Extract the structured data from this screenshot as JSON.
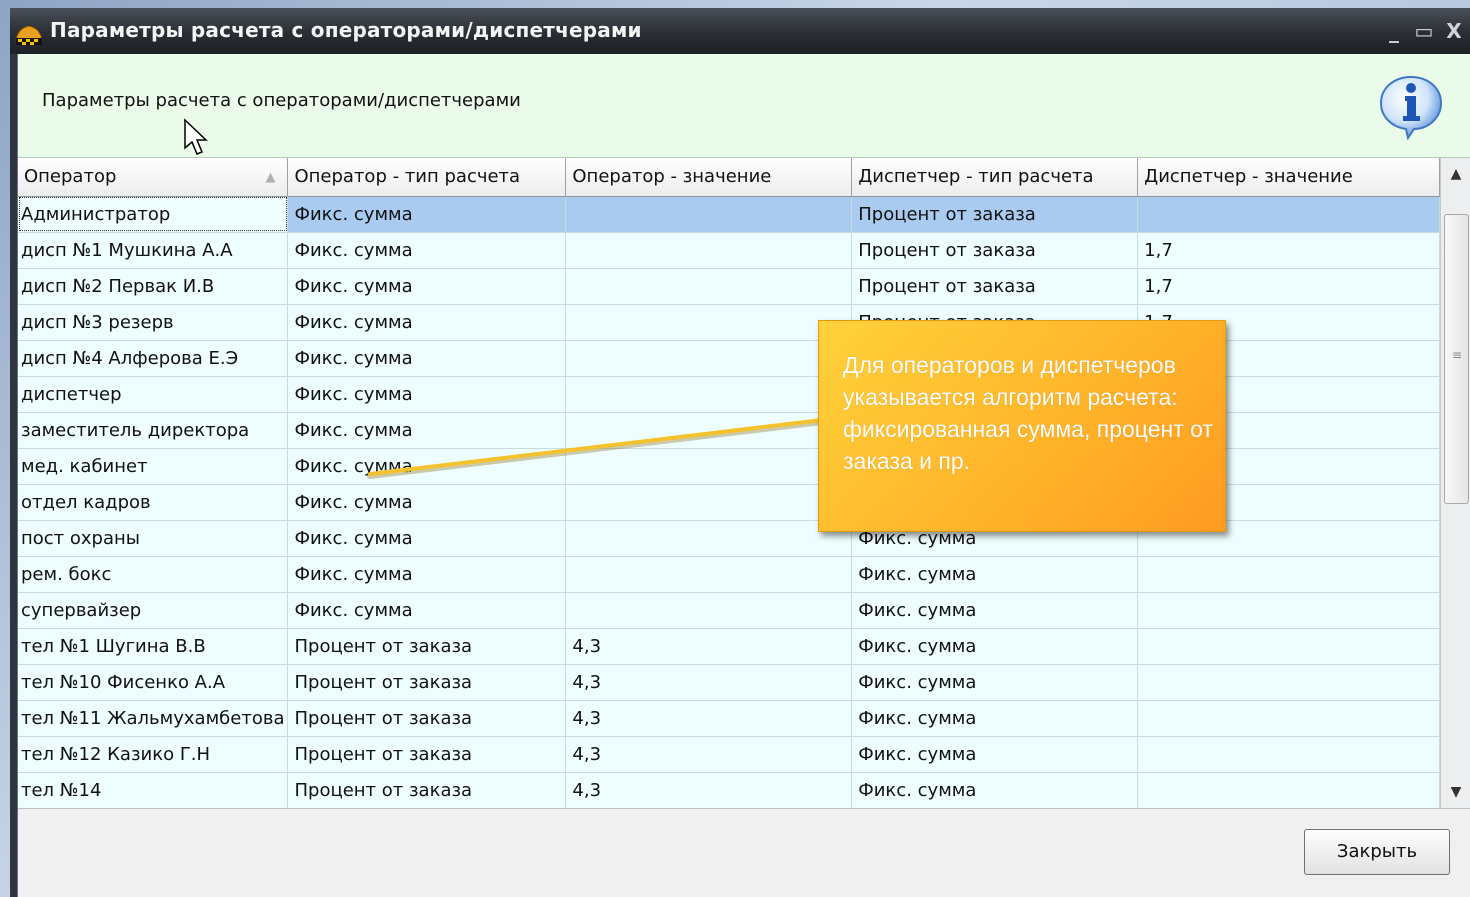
{
  "window": {
    "title": "Параметры расчета с операторами/диспетчерами",
    "minimize_glyph": "_",
    "maximize_glyph": "▭",
    "close_glyph": "X"
  },
  "header": {
    "label": "Параметры расчета с операторами/диспетчерами",
    "icon": "info-icon"
  },
  "table": {
    "columns": [
      "Оператор",
      "Оператор - тип расчета",
      "Оператор - значение",
      "Диспетчер - тип расчета",
      "Диспетчер - значение"
    ],
    "sort_indicator": "▲",
    "rows": [
      [
        "Администратор",
        "Фикс. сумма",
        "",
        "Процент от заказа",
        ""
      ],
      [
        "дисп №1 Мушкина А.А",
        "Фикс. сумма",
        "",
        "Процент от заказа",
        "1,7"
      ],
      [
        "дисп №2 Первак И.В",
        "Фикс. сумма",
        "",
        "Процент от заказа",
        "1,7"
      ],
      [
        "дисп №3 резерв",
        "Фикс. сумма",
        "",
        "Процент от заказа",
        "1,7"
      ],
      [
        "дисп №4 Алферова Е.Э",
        "Фикс. сумма",
        "",
        "",
        ""
      ],
      [
        "диспетчер",
        "Фикс. сумма",
        "",
        "",
        ""
      ],
      [
        "заместитель директора",
        "Фикс. сумма",
        "",
        "",
        ""
      ],
      [
        "мед. кабинет",
        "Фикс. сумма",
        "",
        "",
        ""
      ],
      [
        "отдел кадров",
        "Фикс. сумма",
        "",
        "",
        ""
      ],
      [
        "пост охраны",
        "Фикс. сумма",
        "",
        "Фикс. сумма",
        ""
      ],
      [
        "рем. бокс",
        "Фикс. сумма",
        "",
        "Фикс. сумма",
        ""
      ],
      [
        "супервайзер",
        "Фикс. сумма",
        "",
        "Фикс. сумма",
        ""
      ],
      [
        "тел №1 Шугина В.В",
        "Процент от заказа",
        "4,3",
        "Фикс. сумма",
        ""
      ],
      [
        "тел №10 Фисенко А.А",
        "Процент от заказа",
        "4,3",
        "Фикс. сумма",
        ""
      ],
      [
        "тел №11 Жальмухамбетова",
        "Процент от заказа",
        "4,3",
        "Фикс. сумма",
        ""
      ],
      [
        "тел №12 Казико Г.Н",
        "Процент от заказа",
        "4,3",
        "Фикс. сумма",
        ""
      ],
      [
        "тел №14",
        "Процент от заказа",
        "4,3",
        "Фикс. сумма",
        ""
      ]
    ],
    "selected_row": 0
  },
  "scrollbar": {
    "up_glyph": "▲",
    "down_glyph": "▼",
    "grip_glyph": "≡"
  },
  "footer": {
    "close_label": "Закрыть"
  },
  "callout": {
    "text": "Для операторов и диспетчеров указывается алгоритм расчета: фиксированная сумма, процент от заказа и пр."
  },
  "colors": {
    "header_bg": "#eafbe9",
    "grid_bg": "#eefefe",
    "selected_row": "#a9cbef",
    "callout": "#ffb52a",
    "titlebar": "#2a2e34"
  }
}
